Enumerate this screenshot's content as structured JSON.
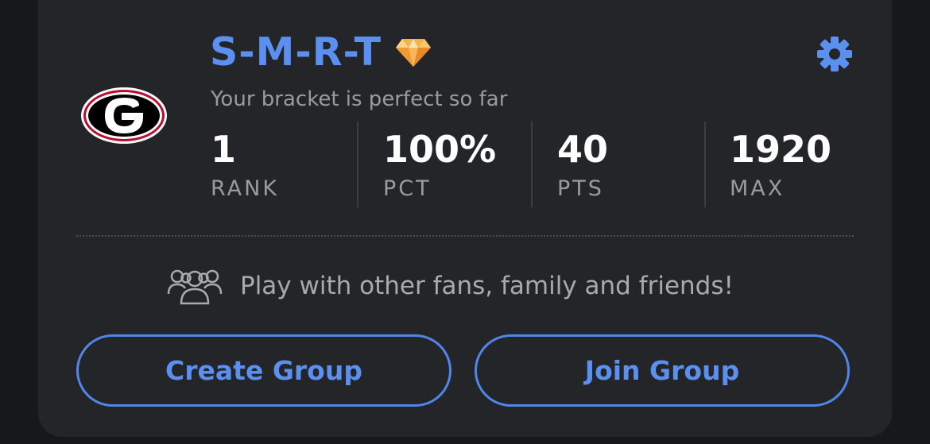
{
  "header": {
    "title": "S-M-R-T",
    "badge_icon": "diamond-icon",
    "subtitle": "Your bracket is perfect so far",
    "settings_icon": "gear-icon",
    "team_logo": "georgia-g-logo"
  },
  "stats": [
    {
      "value": "1",
      "label": "RANK"
    },
    {
      "value": "100%",
      "label": "PCT"
    },
    {
      "value": "40",
      "label": "PTS"
    },
    {
      "value": "1920",
      "label": "MAX"
    }
  ],
  "invite": {
    "icon": "people-group-icon",
    "text": "Play with other fans, family and friends!"
  },
  "buttons": {
    "create": "Create Group",
    "join": "Join Group"
  },
  "colors": {
    "accent": "#5b8ff0",
    "card_bg": "#242528",
    "page_bg": "#17181a",
    "logo_red": "#ba0c2f"
  }
}
